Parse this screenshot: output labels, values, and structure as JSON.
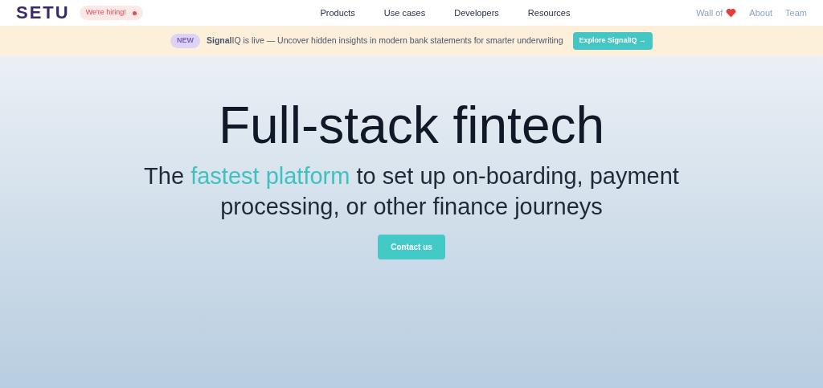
{
  "header": {
    "logo": "SETU",
    "hiring_badge": "We're hiring!",
    "nav": [
      "Products",
      "Use cases",
      "Developers",
      "Resources"
    ],
    "right_links": [
      {
        "label": "Wall of",
        "kind": "heart"
      },
      {
        "label": "About",
        "kind": "plain"
      },
      {
        "label": "Team",
        "kind": "plain"
      }
    ]
  },
  "banner": {
    "badge": "NEW",
    "text": "**Signal**IQ is live — Uncover hidden insights in modern bank statements for smarter underwriting",
    "button": "Explore SignalIQ →"
  },
  "hero": {
    "title": "Full-stack fintech",
    "subtitle_start": "The ",
    "subtitle_highlight": "fastest platform",
    "subtitle_end": " to set up on-boarding, payment processing, or other finance journeys",
    "button": "Contact us"
  }
}
